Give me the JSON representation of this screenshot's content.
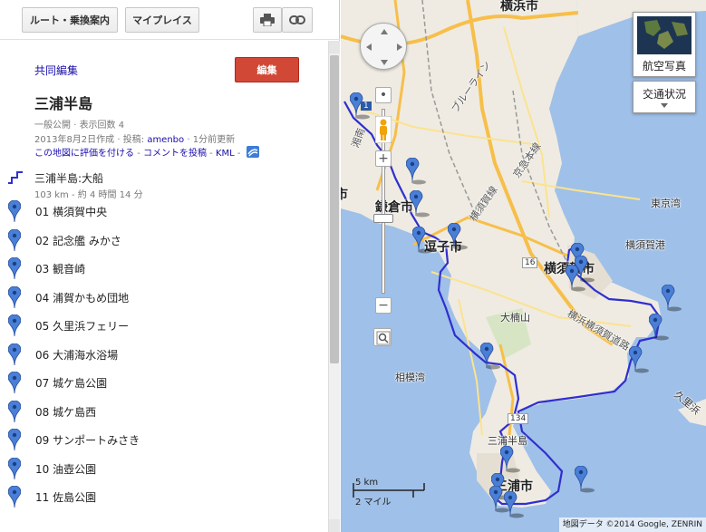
{
  "toolbar": {
    "route_label": "ルート・乗換案内",
    "myplaces_label": "マイプレイス",
    "print_icon": "printer-icon",
    "link_icon": "link-icon"
  },
  "header": {
    "collab_label": "共同編集",
    "edit_label": "編集",
    "title": "三浦半島"
  },
  "meta": {
    "visibility": "一般公開",
    "views_label": "表示回数",
    "views_count": "4",
    "created": "2013年8月2日作成",
    "posted_by_label": "投稿:",
    "author": "amenbo",
    "updated": "1分前更新",
    "rate_label": "この地図に評価を付ける",
    "comment_label": "コメントを投稿",
    "kml_label": "KML",
    "separator": "·",
    "separator2": "-"
  },
  "route": {
    "name": "三浦半島:大船",
    "distance": "103 km",
    "duration": "約 4 時間 14 分"
  },
  "places": [
    {
      "label": "01  横須賀中央"
    },
    {
      "label": "02 記念艦  みかさ"
    },
    {
      "label": "03  観音崎"
    },
    {
      "label": "04  浦賀かもめ団地"
    },
    {
      "label": "05  久里浜フェリー"
    },
    {
      "label": "06  大浦海水浴場"
    },
    {
      "label": "07 城ケ島公園"
    },
    {
      "label": "08  城ケ島西"
    },
    {
      "label": "09  サンポートみさき"
    },
    {
      "label": "10  油壺公園"
    },
    {
      "label": "11 佐島公園"
    }
  ],
  "map": {
    "labels": {
      "yokohama": "横浜市",
      "kamakura": "鎌倉市",
      "zushi": "逗子市",
      "yokosuka": "横須賀市",
      "miura": "三浦市",
      "miura_peninsula": "三浦半島",
      "tokyo_bay": "東京湾",
      "sagami_bay": "相模湾",
      "okusuyama": "大楠山",
      "yokosuka_port": "横須賀港",
      "kurihama": "久里浜",
      "blue_line": "ブルーライン",
      "keikyu": "京急本線",
      "yokosuka_line": "横須賀線",
      "yokohama_yokosuka_road": "横浜横須賀道路",
      "shonan": "湘南",
      "route16": "16",
      "route134": "134",
      "route1": "1",
      "shi_left": "市",
      "hama_top": "浜市"
    },
    "satellite_label": "航空写真",
    "traffic_label": "交通状況",
    "scale_km": "5 km",
    "scale_mi": "2 マイル",
    "attribution": "地図データ ©2014 Google, ZENRIN",
    "colors": {
      "land": "#efebe2",
      "sea": "#9fc0e8",
      "highway": "#f7bf4a",
      "road": "#fbe38f",
      "route": "#2f2fd0",
      "pin": "#4a7fd8"
    }
  }
}
